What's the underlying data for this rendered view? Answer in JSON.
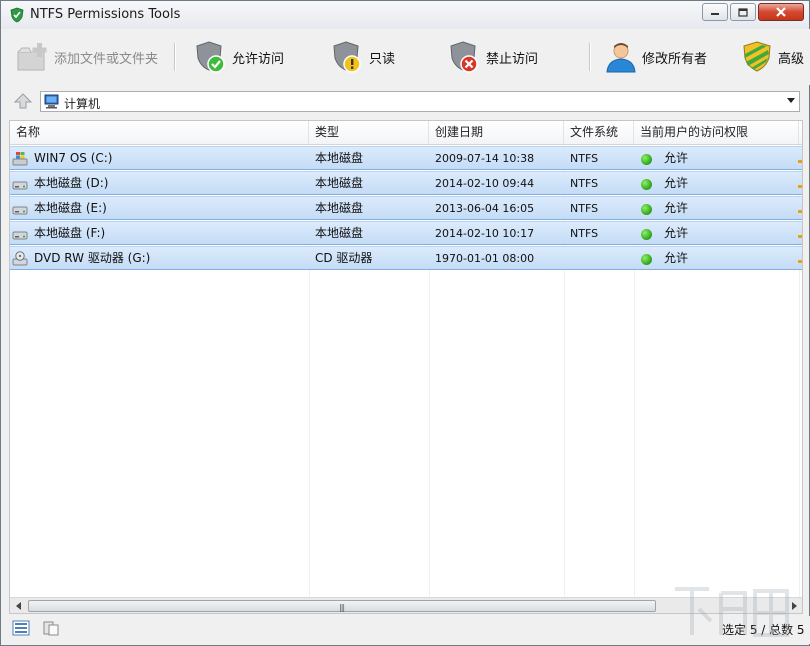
{
  "window": {
    "title": "NTFS Permissions Tools"
  },
  "toolbar": {
    "add": "添加文件或文件夹",
    "allow": "允许访问",
    "readonly": "只读",
    "deny": "禁止访问",
    "owner": "修改所有者",
    "advanced": "高级"
  },
  "address": {
    "value": "计算机"
  },
  "columns": [
    "名称",
    "类型",
    "创建日期",
    "文件系统",
    "当前用户的访问权限"
  ],
  "rows": [
    {
      "icon": "windows-drive-icon",
      "name": "WIN7 OS (C:)",
      "type": "本地磁盘",
      "date": "2009-07-14 10:38",
      "fs": "NTFS",
      "access": "允许"
    },
    {
      "icon": "hard-drive-icon",
      "name": "本地磁盘 (D:)",
      "type": "本地磁盘",
      "date": "2014-02-10 09:44",
      "fs": "NTFS",
      "access": "允许"
    },
    {
      "icon": "hard-drive-icon",
      "name": "本地磁盘 (E:)",
      "type": "本地磁盘",
      "date": "2013-06-04 16:05",
      "fs": "NTFS",
      "access": "允许"
    },
    {
      "icon": "hard-drive-icon",
      "name": "本地磁盘 (F:)",
      "type": "本地磁盘",
      "date": "2014-02-10 10:17",
      "fs": "NTFS",
      "access": "允许"
    },
    {
      "icon": "dvd-drive-icon",
      "name": "DVD RW 驱动器 (G:)",
      "type": "CD 驱动器",
      "date": "1970-01-01 08:00",
      "fs": "",
      "access": "允许"
    }
  ],
  "status": {
    "text": "选定 5 / 总数 5"
  },
  "colors": {
    "selection": "#c4dcf6",
    "allowed_dot": "#2ba11a",
    "close_button": "#c3361c"
  }
}
